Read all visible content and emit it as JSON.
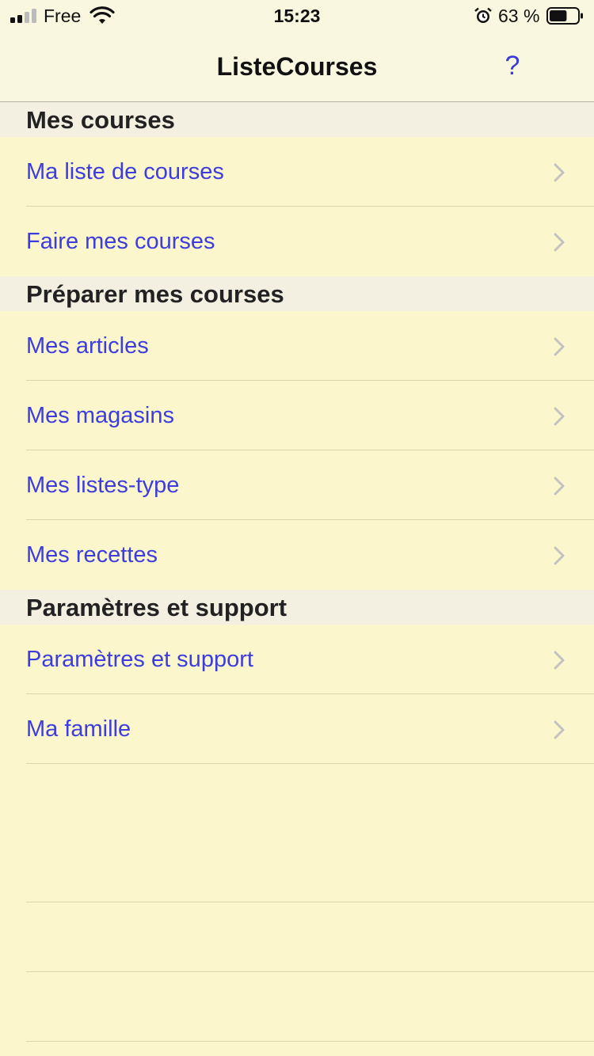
{
  "status_bar": {
    "carrier": "Free",
    "time": "15:23",
    "battery_percent": "63 %",
    "battery_level": 0.63,
    "signal_bars": 2,
    "icons": [
      "signal-icon",
      "wifi-icon",
      "alarm-icon",
      "battery-icon"
    ]
  },
  "nav": {
    "title": "ListeCourses",
    "help_label": "?"
  },
  "sections": [
    {
      "title": "Mes courses",
      "items": [
        {
          "label": "Ma liste de courses"
        },
        {
          "label": "Faire mes courses"
        }
      ]
    },
    {
      "title": "Préparer mes courses",
      "items": [
        {
          "label": "Mes articles"
        },
        {
          "label": "Mes magasins"
        },
        {
          "label": "Mes listes-type"
        },
        {
          "label": "Mes recettes"
        }
      ]
    },
    {
      "title": "Paramètres et support",
      "items": [
        {
          "label": "Paramètres et support"
        },
        {
          "label": "Ma famille"
        }
      ]
    }
  ],
  "colors": {
    "background": "#fbf6cc",
    "section_header_bg": "#f3f0e1",
    "link_text": "#3d3ddd",
    "chevron": "#c2c2c2",
    "separator": "#d9d3ae"
  }
}
